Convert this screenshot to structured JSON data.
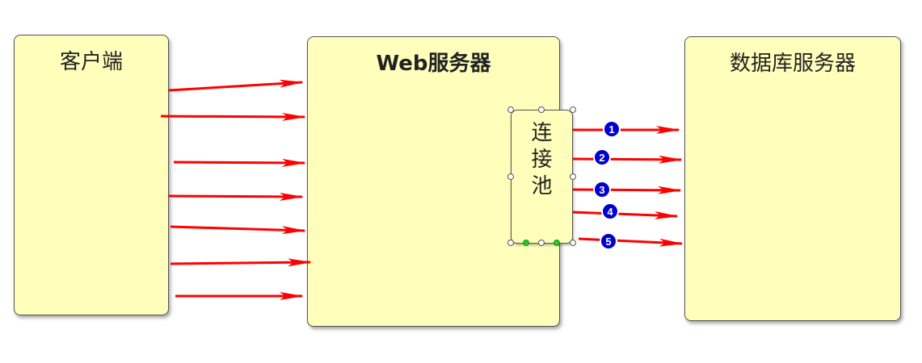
{
  "diagram": {
    "client": {
      "title": "客户端"
    },
    "web_server": {
      "title": "Web服务器"
    },
    "pool": {
      "chars": [
        "连",
        "接",
        "池"
      ]
    },
    "db_server": {
      "title": "数据库服务器"
    },
    "connection_badges": [
      "1",
      "2",
      "3",
      "4",
      "5"
    ],
    "colors": {
      "box_fill": "#ffffbb",
      "arrow": "#ff0000",
      "badge_fill": "#0000cc",
      "handle_green": "#22cc22"
    }
  }
}
